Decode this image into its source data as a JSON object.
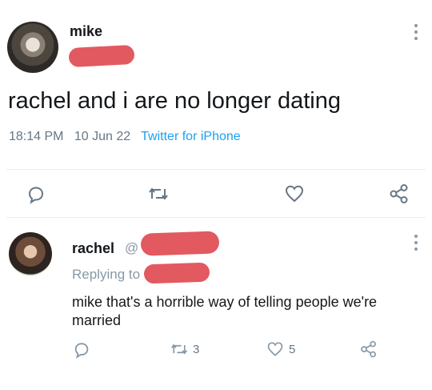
{
  "tweet": {
    "author_name": "mike",
    "text": "rachel and i are no longer dating",
    "time": "18:14 PM",
    "date": "10 Jun 22",
    "source": "Twitter for iPhone",
    "actions": {
      "reply_icon": "reply-icon",
      "retweet_icon": "retweet-icon",
      "like_icon": "heart-icon",
      "share_icon": "share-icon"
    }
  },
  "reply": {
    "author_name": "rachel",
    "handle_prefix": "@",
    "replying_to": "Replying to",
    "text_line1": "mike that's a horrible way of telling people we're",
    "text_line2": "married",
    "retweet_count": "3",
    "like_count": "5"
  },
  "colors": {
    "redaction": "#e2595f",
    "icon_gray": "#8899a6",
    "source_blue": "#1da1f2"
  }
}
